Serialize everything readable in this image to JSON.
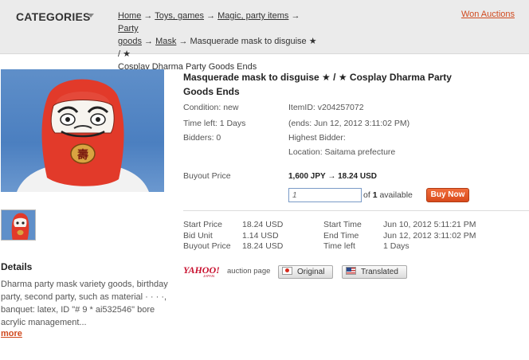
{
  "header": {
    "categories_label": "CATEGORIES",
    "breadcrumb": {
      "home": "Home",
      "toys": "Toys, games",
      "magic": "Magic, party items",
      "party_goods_1": "Party",
      "party_goods_2": "goods",
      "mask": "Mask",
      "current_1": "Masquerade mask to disguise ★ / ★",
      "current_2": "Cosplay Dharma Party Goods Ends",
      "arrow": "→"
    },
    "won_auctions": "Won Auctions"
  },
  "item": {
    "title": "Masquerade mask to disguise ★ / ★ Cosplay Dharma Party Goods Ends",
    "condition": "Condition: new",
    "item_id": "ItemID: v204257072",
    "time_left": "Time left: 1 Days",
    "ends": "(ends: Jun 12, 2012 3:11:02 PM)",
    "bidders": "Bidders: 0",
    "highest_bidder": "Highest Bidder:",
    "location": "Location: Saitama prefecture"
  },
  "buyout": {
    "label": "Buyout Price",
    "jpy": "1,600 JPY",
    "arrow": "→",
    "usd": "18.24 USD",
    "qty_value": "1",
    "of_label": "of",
    "qty_available": "1",
    "available_label": "available",
    "buy_now": "Buy Now"
  },
  "specs": {
    "start_price_label": "Start Price",
    "start_price": "18.24 USD",
    "bid_unit_label": "Bid Unit",
    "bid_unit": "1.14 USD",
    "buyout_price_label": "Buyout Price",
    "buyout_price": "18.24 USD",
    "start_time_label": "Start Time",
    "start_time": "Jun 10, 2012 5:11:21 PM",
    "end_time_label": "End Time",
    "end_time": "Jun 12, 2012 3:11:02 PM",
    "time_left_label": "Time left",
    "time_left": "1 Days"
  },
  "auction": {
    "yahoo_logo": "YAHOO!",
    "yahoo_sub": "JAPAN",
    "page_label": "auction page",
    "original": "Original",
    "translated": "Translated"
  },
  "details": {
    "title": "Details",
    "text": "Dharma party mask variety goods, birthday party, second party, such as material · · · ·, banquet: latex, ID \"# 9 * ai532546\" bore acrylic management...",
    "more": "more"
  },
  "colors": {
    "accent": "#d04a1e",
    "header_bg": "#ebebeb",
    "buy_button": "#e25a29"
  }
}
